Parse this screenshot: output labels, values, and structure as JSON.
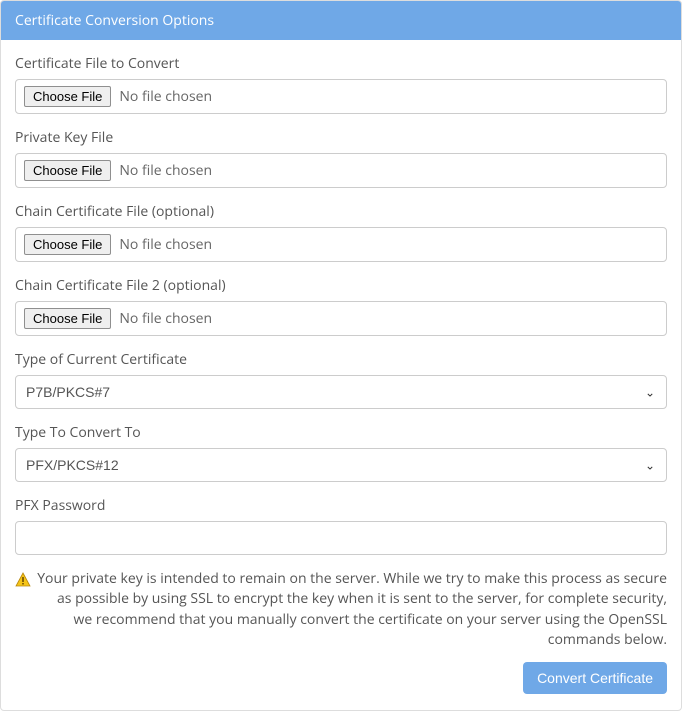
{
  "panel": {
    "title": "Certificate Conversion Options"
  },
  "fields": {
    "cert_file": {
      "label": "Certificate File to Convert",
      "button": "Choose File",
      "status": "No file chosen"
    },
    "private_key": {
      "label": "Private Key File",
      "button": "Choose File",
      "status": "No file chosen"
    },
    "chain1": {
      "label": "Chain Certificate File (optional)",
      "button": "Choose File",
      "status": "No file chosen"
    },
    "chain2": {
      "label": "Chain Certificate File 2 (optional)",
      "button": "Choose File",
      "status": "No file chosen"
    },
    "type_current": {
      "label": "Type of Current Certificate",
      "value": "P7B/PKCS#7"
    },
    "type_convert": {
      "label": "Type To Convert To",
      "value": "PFX/PKCS#12"
    },
    "pfx_password": {
      "label": "PFX Password",
      "value": ""
    }
  },
  "warning": {
    "icon_name": "warning-icon",
    "text": "Your private key is intended to remain on the server. While we try to make this process as secure as possible by using SSL to encrypt the key when it is sent to the server, for complete security, we recommend that you manually convert the certificate on your server using the OpenSSL commands below."
  },
  "actions": {
    "convert": "Convert Certificate"
  }
}
